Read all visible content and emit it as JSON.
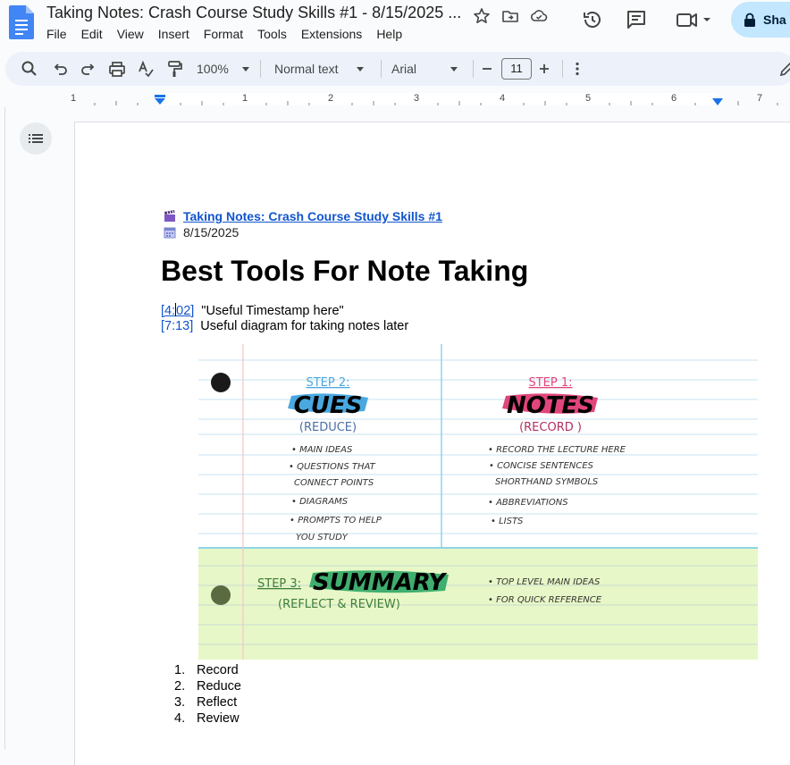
{
  "window": {
    "doc_title": "Taking Notes: Crash Course Study Skills #1 - 8/15/2025 ...",
    "share_label": "Sha"
  },
  "menu": [
    "File",
    "Edit",
    "View",
    "Insert",
    "Format",
    "Tools",
    "Extensions",
    "Help"
  ],
  "toolbar": {
    "zoom": "100%",
    "style": "Normal text",
    "font": "Arial",
    "font_size": "11"
  },
  "ruler": {
    "numbers": [
      "1",
      "1",
      "2",
      "3",
      "4",
      "5",
      "6",
      "7"
    ]
  },
  "doc": {
    "video_link": "Taking Notes: Crash Course Study Skills #1",
    "date": "8/15/2025",
    "heading": "Best Tools For Note Taking",
    "timestamps": [
      {
        "time_a": "[4:",
        "time_b": "02]",
        "note": "\"Useful Timestamp here\""
      },
      {
        "time": "[7:13]",
        "note": "Useful diagram for taking notes later"
      }
    ],
    "list": [
      {
        "num": "1.",
        "text": "Record"
      },
      {
        "num": "2.",
        "text": "Reduce"
      },
      {
        "num": "3.",
        "text": "Reflect"
      },
      {
        "num": "4.",
        "text": "Review"
      }
    ]
  },
  "image": {
    "step2_label": "STEP 2:",
    "cues": "CUES",
    "reduce": "(REDUCE)",
    "step1_label": "STEP 1:",
    "notes": "NOTES",
    "record": "(RECORD )",
    "cues_items": [
      "• MAIN IDEAS",
      "• QUESTIONS THAT",
      "CONNECT POINTS",
      "• DIAGRAMS",
      "• PROMPTS TO HELP",
      "YOU STUDY"
    ],
    "notes_items": [
      "• RECORD THE LECTURE HERE",
      "• CONCISE SENTENCES",
      "SHORTHAND SYMBOLS",
      "• ABBREVIATIONS",
      "• LISTS"
    ],
    "step3_label": "STEP 3:",
    "summary": "SUMMARY",
    "reflect_review": "(REFLECT & REVIEW)",
    "summary_items": [
      "• TOP LEVEL MAIN IDEAS",
      "• FOR QUICK REFERENCE"
    ]
  },
  "colors": {
    "accent_blue": "#1155cc",
    "share_bg": "#c2e7ff",
    "docs_blue": "#4285f4",
    "cues_blue": "#4aa8e0",
    "notes_pink": "#e0457b",
    "summary_green": "#3f7d3a",
    "summary_bg": "#e8f7c7"
  }
}
